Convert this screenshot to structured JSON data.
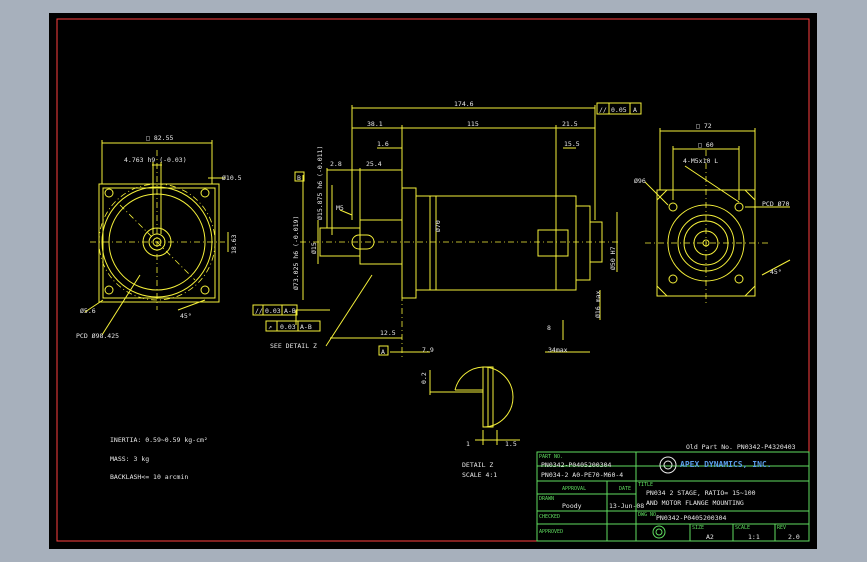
{
  "drawing": {
    "old_part_no": "Old Part No. PN0342-P4320403",
    "notes": {
      "inertia": "INERTIA: 0.59~0.59 kg-cm²",
      "mass": "MASS: 3 kg",
      "backlash": "BACKLASH<= 10 arcmin"
    },
    "detail_label": "DETAIL Z",
    "detail_scale": "SCALE 4:1",
    "see_detail": "SEE DETAIL Z",
    "datum_b": "B",
    "datum_a": "A",
    "tol_top": [
      "//",
      "0.05",
      "A"
    ],
    "tol_parallel": [
      "//",
      "0.03",
      "A-B"
    ],
    "tol_runout": [
      "↗",
      "0.03",
      "A-B"
    ]
  },
  "dimensions": {
    "overall": "174.6",
    "len_38": "38.1",
    "len_115": "115",
    "len_21": "21.5",
    "len_15": "15.5",
    "len_16": "1.6",
    "len_28": "2.8",
    "len_25": "25.4",
    "len_125": "12.5",
    "len_79": "7.9",
    "len_34": "34max",
    "len_8": "8",
    "dia_70": "Ø70",
    "dia_50": "Ø50 H7",
    "dia_16": "Ø16 max",
    "shaft_dia": "Ø15.875 h6 (-0.011)",
    "pilot_dia": "Ø73.025 h6 (-0.019)",
    "dia_15": "Ø15",
    "m5": "M5",
    "sq_front": "□ 82.55",
    "key_w": "4.763 h9 (-0.03)",
    "hole_front": "Ø10.5",
    "key_h": "18.63",
    "hole_small": "Ø5.6",
    "pcd_front": "PCD Ø98.425",
    "angle_front": "45°",
    "sq_back1": "□ 72",
    "sq_back2": "□ 60",
    "tap_back": "4-M5x10 L",
    "dia_96": "Ø96",
    "pcd_back": "PCD Ø70",
    "angle_back": "45°",
    "detail_a": "0.2",
    "detail_b": "1.5",
    "detail_c": "1"
  },
  "title_block": {
    "part_no_label": "PART NO.",
    "part_no_1": "PN0342-P0405200304",
    "part_no_2": "PN034-2 A0-PE70-M60-4",
    "approval": "APPROVAL",
    "date": "DATE",
    "drawn_label": "DRAWN",
    "drawn": "Poody",
    "drawn_date": "13-Jun-08",
    "checked": "CHECKED",
    "approved": "APPROVED",
    "company": "APEX DYNAMICS, INC.",
    "title_label": "TITLE",
    "title_1": "PN034 2 STAGE, RATIO= 15~100",
    "title_2": "AND MOTOR FLANGE MOUNTING",
    "dwg_no_label": "DWG NO.",
    "dwg_no": "PN0342-P0405200304",
    "size_label": "SIZE",
    "size": "A2",
    "scale_label": "SCALE",
    "scale": "1:1",
    "rev_label": "REV",
    "rev": "2.0"
  },
  "colors": {
    "background": "#a7b0bc",
    "sheet": "#000000",
    "lines": "#f5f03a",
    "text": "#e8e8e8",
    "titleblock": "#5fdc5f",
    "border": "#ff4040"
  }
}
